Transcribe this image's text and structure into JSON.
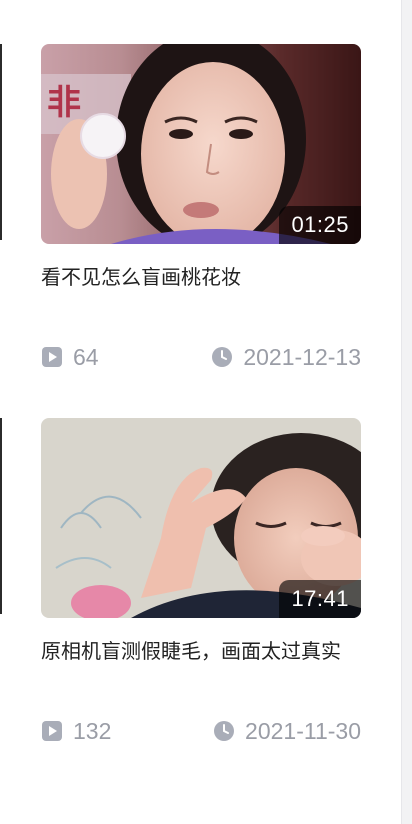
{
  "videos": [
    {
      "title": "看不见怎么盲画桃花妆",
      "duration": "01:25",
      "plays": "64",
      "date": "2021-12-13",
      "thumbnail_icon": "face-cotton-pad-thumbnail"
    },
    {
      "title": "原相机盲测假睫毛，画面太过真实",
      "duration": "17:41",
      "plays": "132",
      "date": "2021-11-30",
      "thumbnail_icon": "eyelash-test-thumbnail"
    }
  ],
  "icons": {
    "play": "play-count-icon",
    "clock": "clock-icon"
  },
  "colors": {
    "meta_text": "#9a9da6",
    "title_text": "#222222",
    "icon_fill": "#a9adb8"
  }
}
